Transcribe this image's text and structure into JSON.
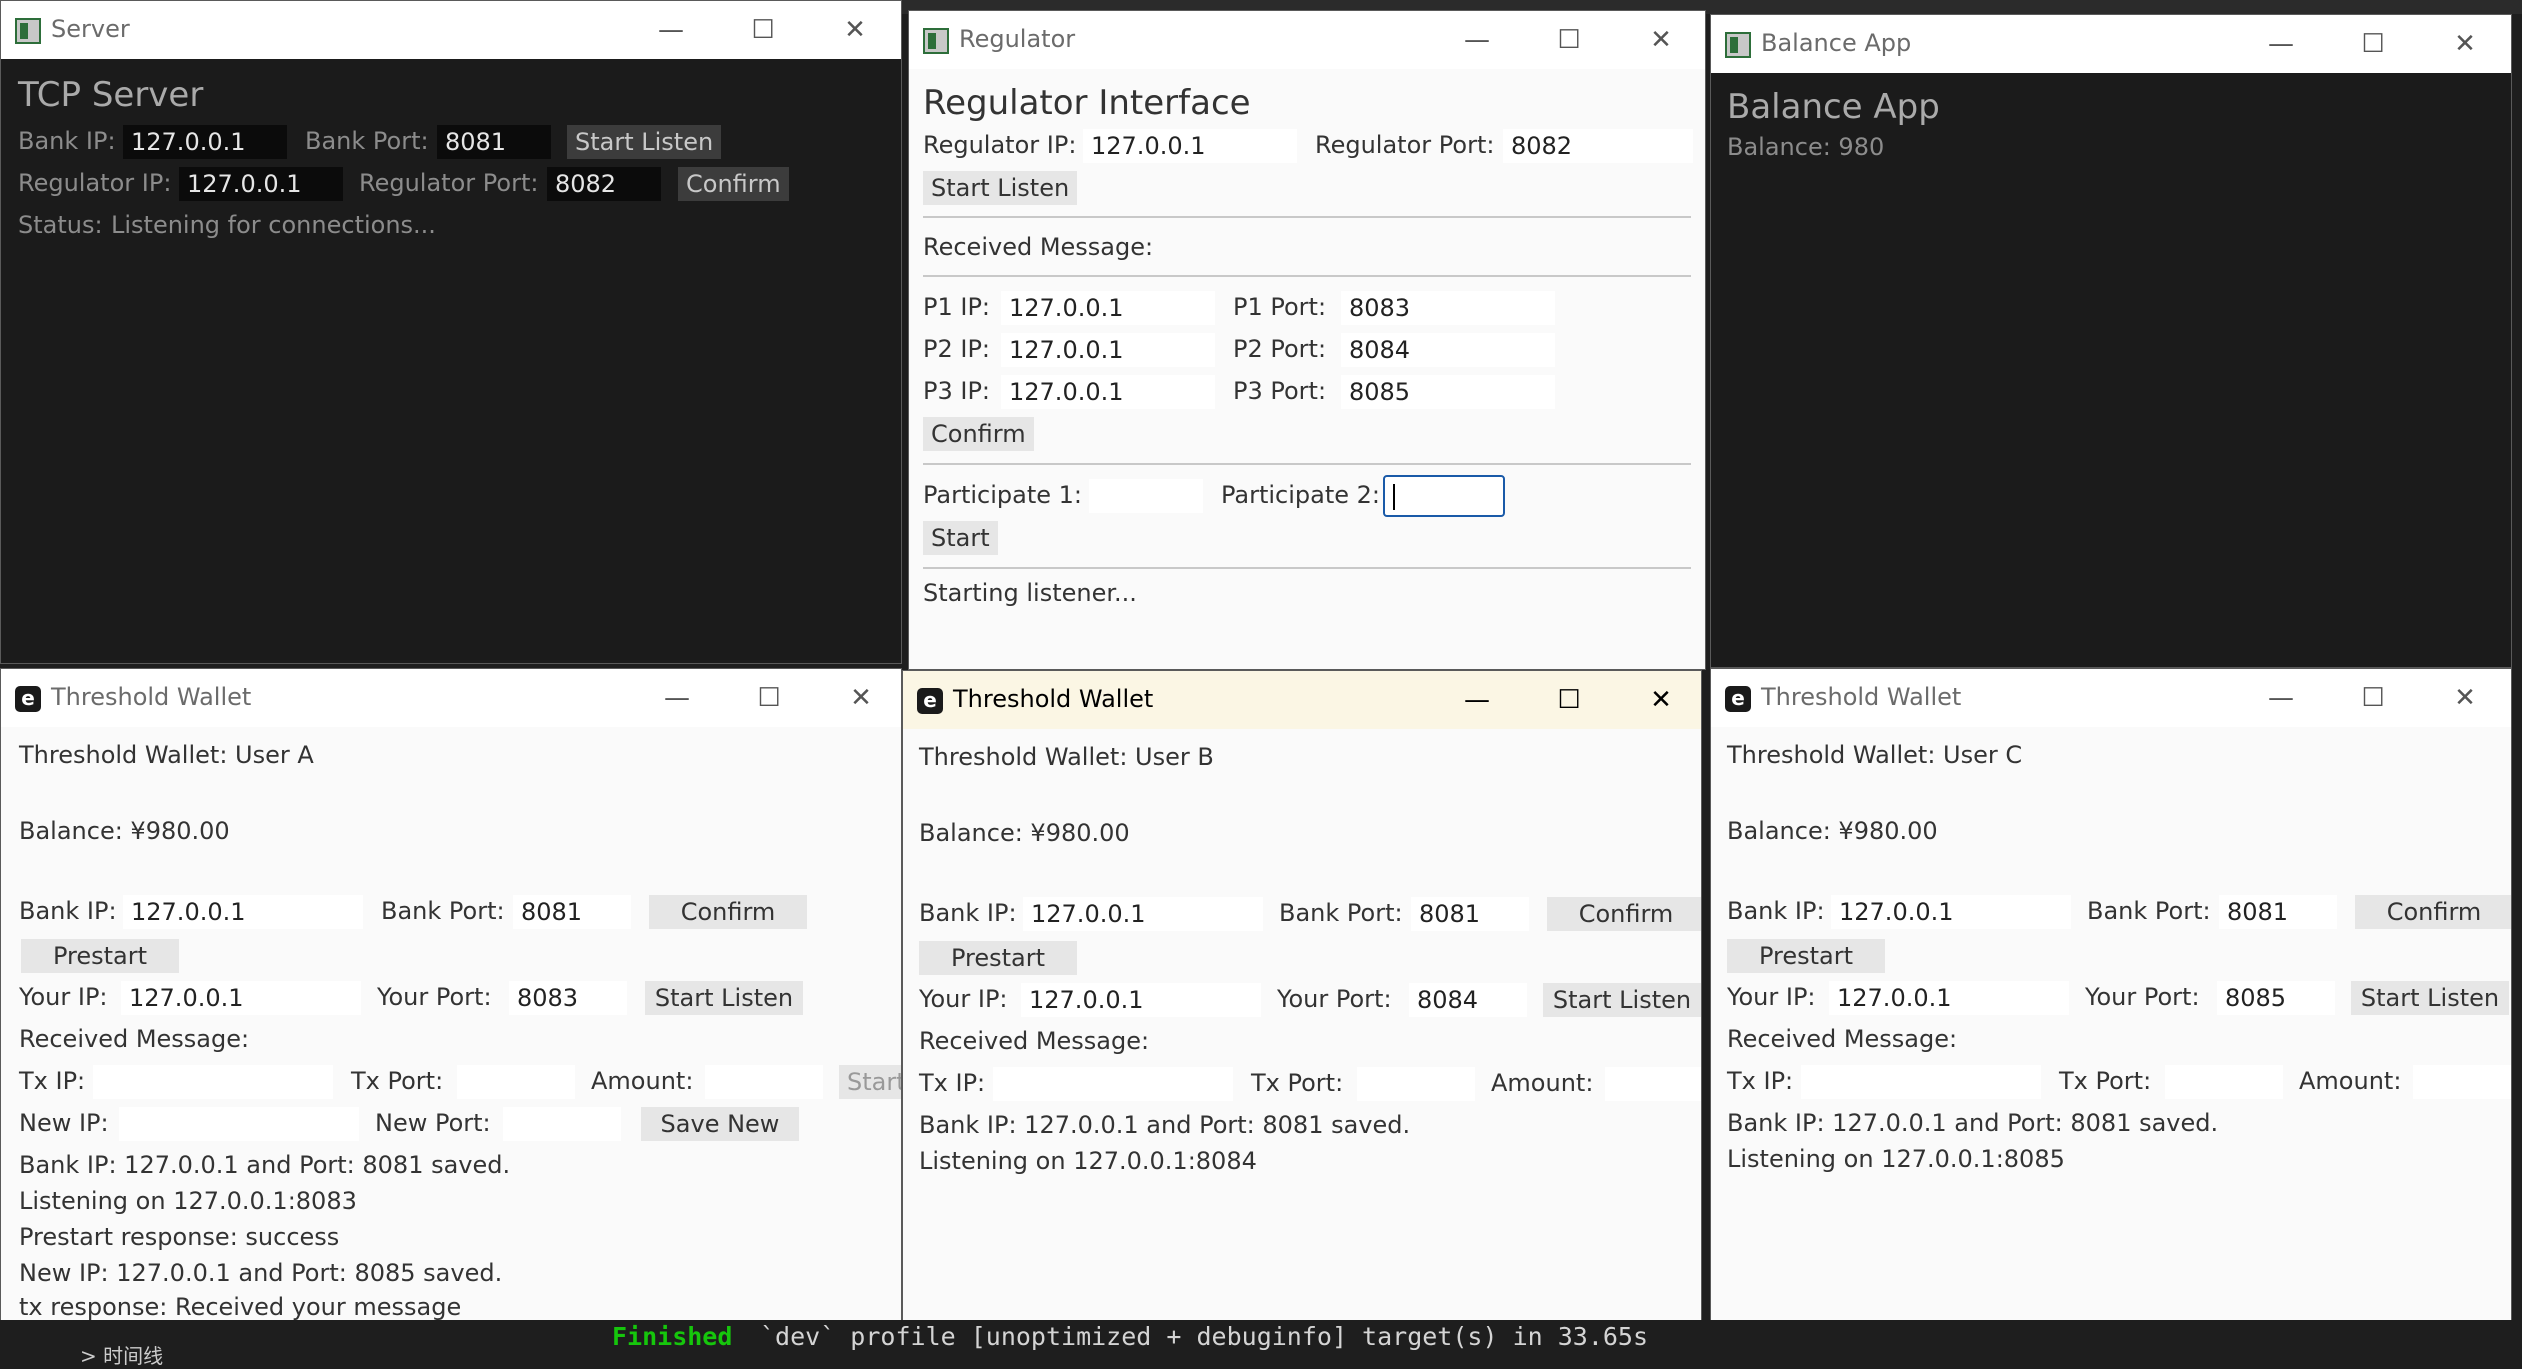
{
  "terminal": {
    "finished": "Finished",
    "rest": "`dev` profile [unoptimized + debuginfo] target(s) in 33.65s",
    "panel_chevron": "> 时间线"
  },
  "server": {
    "window_title": "Server",
    "heading": "TCP Server",
    "bank_ip_label": "Bank IP:",
    "bank_ip": "127.0.0.1",
    "bank_port_label": "Bank Port:",
    "bank_port": "8081",
    "start_listen": "Start Listen",
    "regulator_ip_label": "Regulator IP:",
    "regulator_ip": "127.0.0.1",
    "regulator_port_label": "Regulator Port:",
    "regulator_port": "8082",
    "confirm": "Confirm",
    "status_label": "Status:",
    "status": "Listening for connections..."
  },
  "regulator": {
    "window_title": "Regulator",
    "heading": "Regulator Interface",
    "regulator_ip_label": "Regulator IP:",
    "regulator_ip": "127.0.0.1",
    "regulator_port_label": "Regulator Port:",
    "regulator_port": "8082",
    "start_listen": "Start Listen",
    "received_label": "Received Message:",
    "p1_ip_label": "P1 IP:",
    "p1_ip": "127.0.0.1",
    "p1_port_label": "P1 Port:",
    "p1_port": "8083",
    "p2_ip_label": "P2 IP:",
    "p2_ip": "127.0.0.1",
    "p2_port_label": "P2 Port:",
    "p2_port": "8084",
    "p3_ip_label": "P3 IP:",
    "p3_ip": "127.0.0.1",
    "p3_port_label": "P3 Port:",
    "p3_port": "8085",
    "confirm": "Confirm",
    "participate1_label": "Participate 1:",
    "participate2_label": "Participate 2:",
    "start": "Start",
    "status": "Starting listener..."
  },
  "balance_app": {
    "window_title": "Balance App",
    "heading": "Balance App",
    "balance": "Balance: 980"
  },
  "wallet_a": {
    "window_title": "Threshold Wallet",
    "heading": "Threshold Wallet: User A",
    "balance": "Balance: ¥980.00",
    "bank_ip_label": "Bank IP:",
    "bank_ip": "127.0.0.1",
    "bank_port_label": "Bank Port:",
    "bank_port": "8081",
    "confirm": "Confirm",
    "prestart": "Prestart",
    "your_ip_label": "Your IP:",
    "your_ip": "127.0.0.1",
    "your_port_label": "Your Port:",
    "your_port": "8083",
    "start_listen": "Start Listen",
    "received_label": "Received Message:",
    "tx_ip_label": "Tx IP:",
    "tx_port_label": "Tx Port:",
    "amount_label": "Amount:",
    "start_truncated": "Start",
    "new_ip_label": "New IP:",
    "new_port_label": "New Port:",
    "save_new": "Save New",
    "log": [
      "Bank IP: 127.0.0.1 and Port: 8081 saved.",
      "Listening on 127.0.0.1:8083",
      "Prestart response: success",
      "New IP: 127.0.0.1 and Port: 8085 saved.",
      "tx response: Received your message"
    ]
  },
  "wallet_b": {
    "window_title": "Threshold Wallet",
    "heading": "Threshold Wallet: User B",
    "balance": "Balance: ¥980.00",
    "bank_ip_label": "Bank IP:",
    "bank_ip": "127.0.0.1",
    "bank_port_label": "Bank Port:",
    "bank_port": "8081",
    "confirm": "Confirm",
    "prestart": "Prestart",
    "your_ip_label": "Your IP:",
    "your_ip": "127.0.0.1",
    "your_port_label": "Your Port:",
    "your_port": "8084",
    "start_listen": "Start Listen",
    "received_label": "Received Message:",
    "tx_ip_label": "Tx IP:",
    "tx_port_label": "Tx Port:",
    "amount_label": "Amount:",
    "log": [
      "Bank IP: 127.0.0.1 and Port: 8081 saved.",
      "Listening on 127.0.0.1:8084"
    ]
  },
  "wallet_c": {
    "window_title": "Threshold Wallet",
    "heading": "Threshold Wallet: User C",
    "balance": "Balance: ¥980.00",
    "bank_ip_label": "Bank IP:",
    "bank_ip": "127.0.0.1",
    "bank_port_label": "Bank Port:",
    "bank_port": "8081",
    "confirm": "Confirm",
    "prestart": "Prestart",
    "your_ip_label": "Your IP:",
    "your_ip": "127.0.0.1",
    "your_port_label": "Your Port:",
    "your_port": "8085",
    "start_listen": "Start Listen",
    "received_label": "Received Message:",
    "tx_ip_label": "Tx IP:",
    "tx_port_label": "Tx Port:",
    "amount_label": "Amount:",
    "log": [
      "Bank IP: 127.0.0.1 and Port: 8081 saved.",
      "Listening on 127.0.0.1:8085"
    ]
  },
  "window_controls": {
    "minimize": "—",
    "maximize": "☐",
    "close": "✕"
  }
}
